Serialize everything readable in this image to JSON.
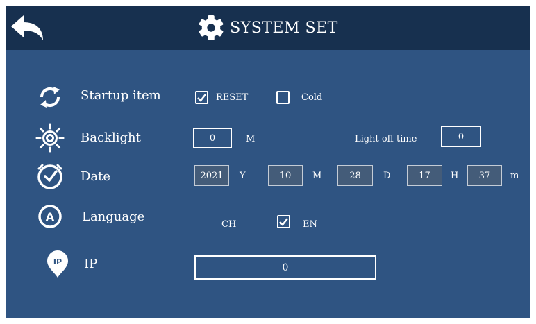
{
  "header": {
    "title": "SYSTEM SET",
    "back_icon": "back-arrow-icon",
    "title_icon": "gear-icon"
  },
  "startup": {
    "label": "Startup item",
    "icon": "restart-icon",
    "options": [
      {
        "label": "RESET",
        "checked": true
      },
      {
        "label": "Cold",
        "checked": false
      }
    ]
  },
  "backlight": {
    "label": "Backlight",
    "icon": "brightness-icon",
    "value": "0",
    "unit": "M",
    "light_off_label": "Light off time",
    "light_off_value": "0"
  },
  "date": {
    "label": "Date",
    "icon": "clock-icon",
    "year": "2021",
    "year_unit": "Y",
    "month": "10",
    "month_unit": "M",
    "day": "28",
    "day_unit": "D",
    "hour": "17",
    "hour_unit": "H",
    "minute": "37",
    "minute_unit": "m"
  },
  "language": {
    "label": "Language",
    "icon": "language-a-icon",
    "icon_letter": "A",
    "options": [
      {
        "label": "CH",
        "checked": false
      },
      {
        "label": "EN",
        "checked": true
      }
    ]
  },
  "ip": {
    "label": "IP",
    "icon": "ip-pin-icon",
    "icon_text": "IP",
    "value": "0"
  },
  "colors": {
    "header": "#17304f",
    "panel": "#2f5482",
    "text": "#ffffff"
  }
}
